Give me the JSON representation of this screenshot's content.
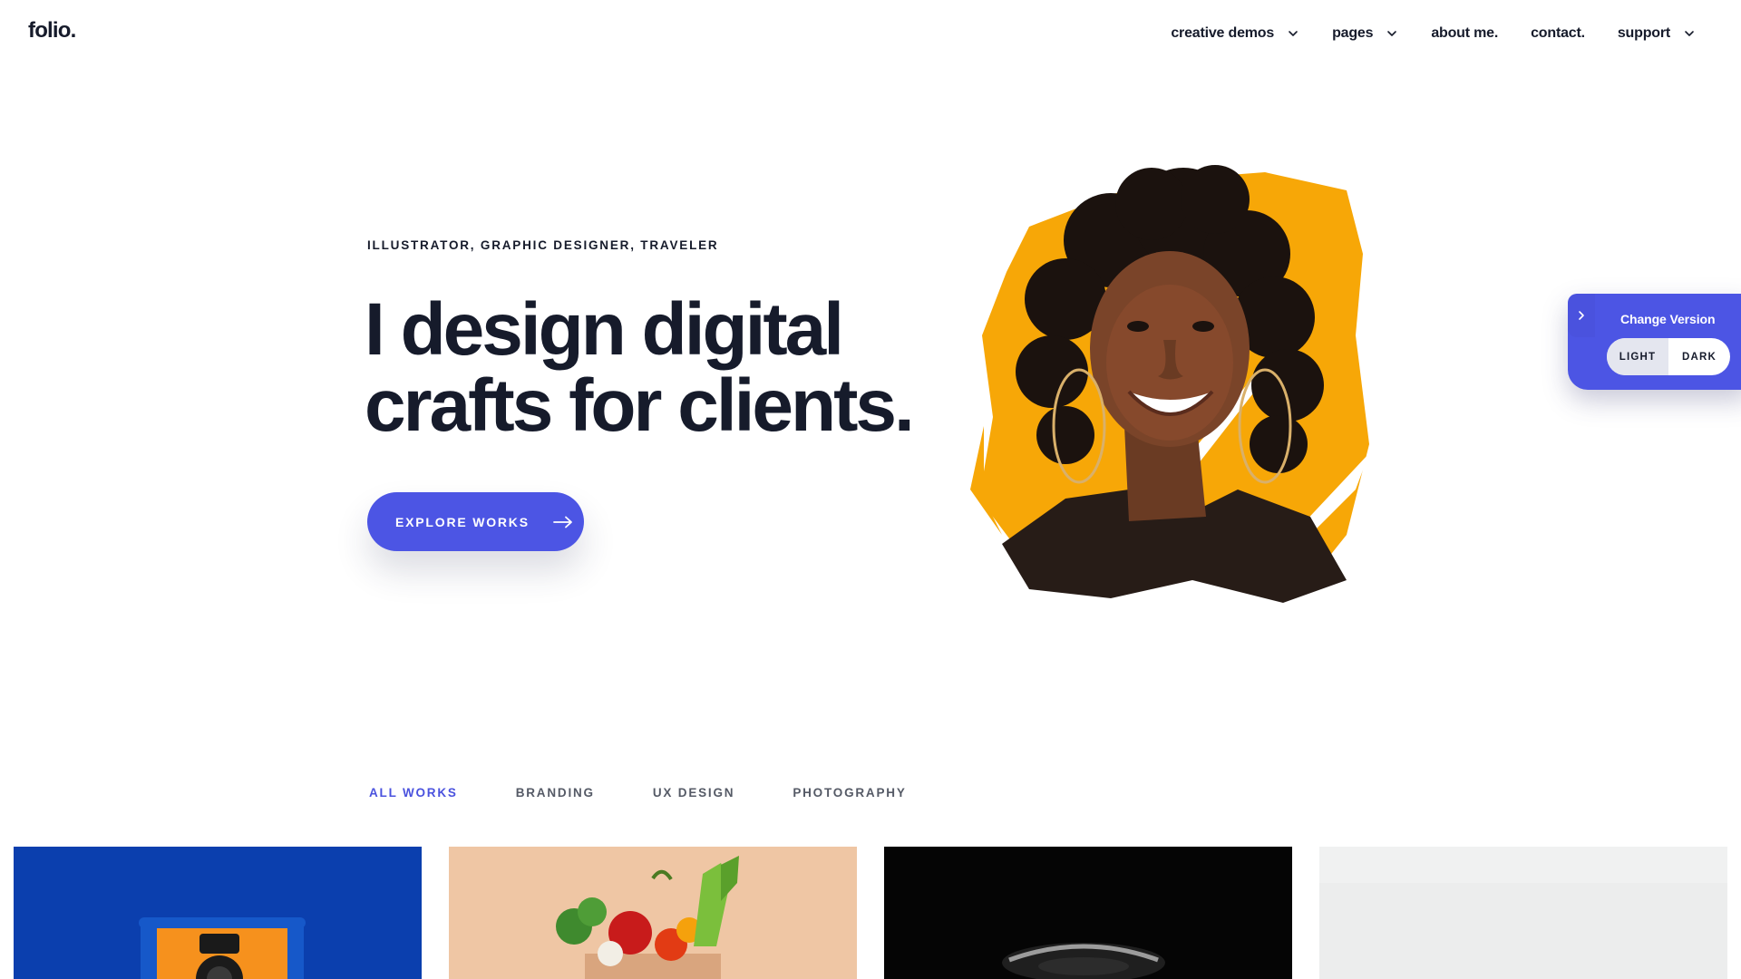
{
  "header": {
    "logo": "folio.",
    "nav": [
      {
        "label": "creative demos",
        "has_dropdown": true
      },
      {
        "label": "pages",
        "has_dropdown": true
      },
      {
        "label": "about me.",
        "has_dropdown": false
      },
      {
        "label": "contact.",
        "has_dropdown": false
      },
      {
        "label": "support",
        "has_dropdown": true
      }
    ]
  },
  "hero": {
    "eyebrow": "ILLUSTRATOR, GRAPHIC DESIGNER, TRAVELER",
    "headline_line1": "I design digital",
    "headline_line2": "crafts for clients.",
    "cta_label": "EXPLORE WORKS",
    "portrait_icon": "portrait-photo",
    "accent_color": "#f7a707"
  },
  "version_panel": {
    "title": "Change Version",
    "options": [
      "LIGHT",
      "DARK"
    ],
    "selected": "LIGHT"
  },
  "portfolio": {
    "filters": [
      "ALL WORKS",
      "BRANDING",
      "UX DESIGN",
      "PHOTOGRAPHY"
    ],
    "active_filter": "ALL WORKS",
    "items": [
      {
        "icon": "camera-photo",
        "bg": "#0b3fae"
      },
      {
        "icon": "grocery-bag-photo",
        "bg": "#efc6a4"
      },
      {
        "icon": "dark-object-photo",
        "bg": "#050505"
      },
      {
        "icon": "light-gray-photo",
        "bg": "#eaebea"
      }
    ]
  },
  "colors": {
    "primary": "#4c55e4",
    "text": "#161b2b",
    "muted": "#555a66"
  }
}
